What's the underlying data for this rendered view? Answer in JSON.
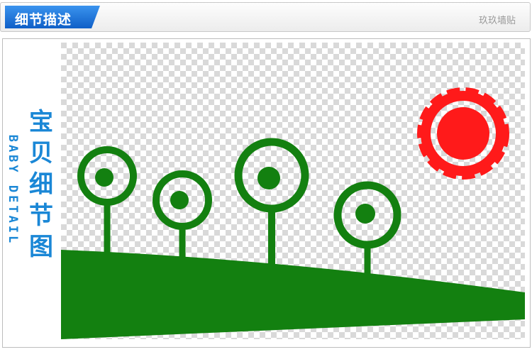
{
  "header": {
    "title": "细节描述",
    "brand": "玖玖墙贴",
    "tab_color": "#1a6fd4"
  },
  "side_labels": {
    "chinese": [
      "宝",
      "贝",
      "细",
      "节",
      "图"
    ],
    "english": "BABY DETAIL"
  },
  "image": {
    "name": "wall sticker artwork",
    "colors": {
      "green": "#138010",
      "red": "#ff1a1a",
      "checker_light": "#ffffff",
      "checker_dark": "#d9d9d9"
    }
  }
}
